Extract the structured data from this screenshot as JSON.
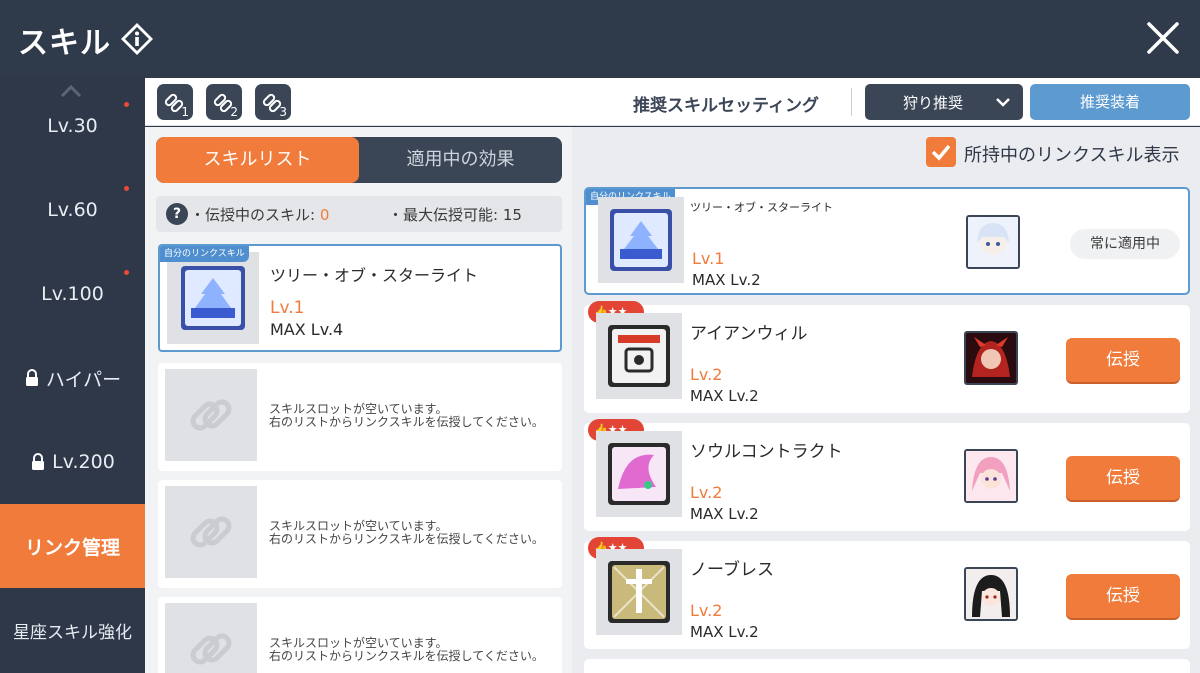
{
  "header": {
    "title": "スキル",
    "close_label": "×"
  },
  "sidebar": {
    "items": [
      {
        "label": "Lv.30",
        "dot": true,
        "locked": false
      },
      {
        "label": "Lv.60",
        "dot": true,
        "locked": false
      },
      {
        "label": "Lv.100",
        "dot": true,
        "locked": false
      },
      {
        "label": "ハイパー",
        "dot": false,
        "locked": true
      },
      {
        "label": "Lv.200",
        "dot": false,
        "locked": true
      },
      {
        "label": "リンク管理",
        "dot": false,
        "locked": false,
        "active": true
      },
      {
        "label": "星座スキル強化",
        "dot": false,
        "locked": false
      }
    ]
  },
  "topbar": {
    "link_tabs": [
      "1",
      "2",
      "3"
    ],
    "recommend_label": "推奨スキルセッティング",
    "dropdown_value": "狩り推奨",
    "equip_button": "推奨装着"
  },
  "left": {
    "tabs": [
      "スキルリスト",
      "適用中の効果"
    ],
    "info_label_1": "・伝授中のスキル: ",
    "info_value_1": "0",
    "info_label_2": "・最大伝授可能: 15",
    "question": "?",
    "own_badge": "自分のリンクスキル",
    "selected_skill": {
      "name": "ツリー・オブ・スターライト",
      "lv": "Lv.1",
      "max": "MAX Lv.4"
    },
    "empty_line_1": "スキルスロットが空いています。",
    "empty_line_2": "右のリストからリンクスキルを伝授してください。"
  },
  "right": {
    "checkbox_label": "所持中のリンクスキル表示",
    "own_badge": "自分のリンクスキル",
    "rec_badge": "★★",
    "always_label": "常に適用中",
    "pass_label": "伝授",
    "cards": [
      {
        "name": "ツリー・オブ・スターライト",
        "lv": "Lv.1",
        "max": "MAX Lv.2",
        "mine": true
      },
      {
        "name": "アイアンウィル",
        "lv": "Lv.2",
        "max": "MAX Lv.2",
        "mine": false
      },
      {
        "name": "ソウルコントラクト",
        "lv": "Lv.2",
        "max": "MAX Lv.2",
        "mine": false
      },
      {
        "name": "ノーブレス",
        "lv": "Lv.2",
        "max": "MAX Lv.2",
        "mine": false
      }
    ]
  },
  "colors": {
    "accent": "#f07b3a",
    "navy": "#2e3848",
    "blue": "#5c9ad0",
    "badge_red": "#e24436"
  }
}
